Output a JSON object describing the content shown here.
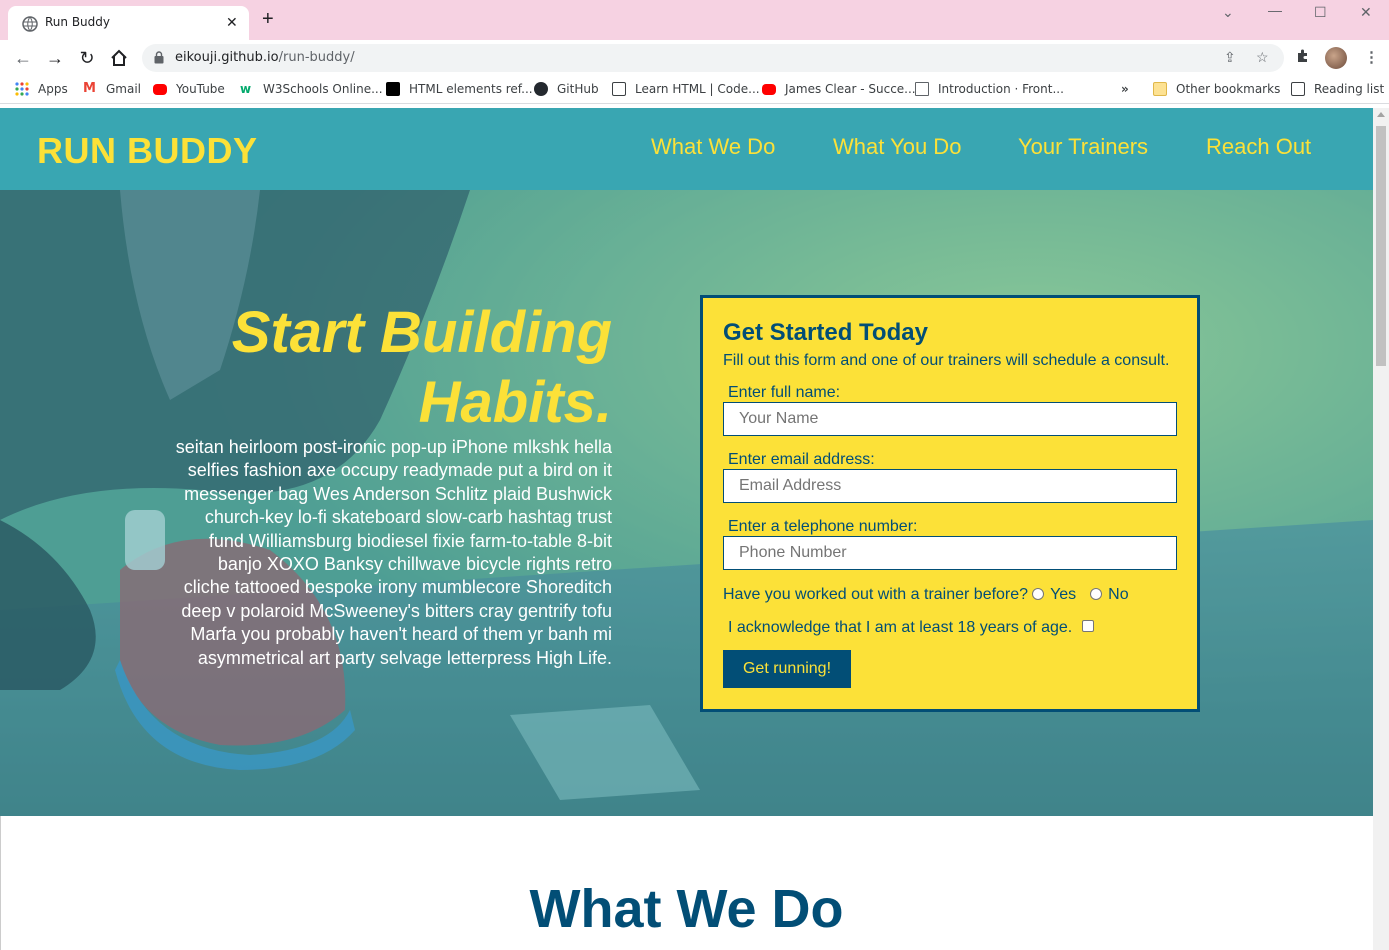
{
  "browser": {
    "tab_title": "Run Buddy",
    "url_host": "eikouji.github.io",
    "url_path": "/run-buddy/",
    "bookmarks": [
      {
        "label": "Apps",
        "icon": "apps-grid-icon",
        "color": "#4285f4"
      },
      {
        "label": "Gmail",
        "icon": "gmail-icon",
        "color": "#ea4335"
      },
      {
        "label": "YouTube",
        "icon": "youtube-icon",
        "color": "#ff0000"
      },
      {
        "label": "W3Schools Online...",
        "icon": "w3schools-icon",
        "color": "#04aa6d"
      },
      {
        "label": "HTML elements ref...",
        "icon": "mdn-icon",
        "color": "#000000"
      },
      {
        "label": "GitHub",
        "icon": "github-icon",
        "color": "#24292f"
      },
      {
        "label": "Learn HTML | Code...",
        "icon": "codecademy-icon",
        "color": "#3c4043"
      },
      {
        "label": "James Clear - Succe...",
        "icon": "youtube-icon",
        "color": "#ff0000"
      },
      {
        "label": "Introduction · Front...",
        "icon": "book-icon",
        "color": "#5f6368"
      }
    ],
    "more_bookmarks": "»",
    "other_bookmarks": "Other bookmarks",
    "reading_list": "Reading list"
  },
  "header": {
    "logo": "RUN BUDDY",
    "nav": [
      "What We Do",
      "What You Do",
      "Your Trainers",
      "Reach Out"
    ]
  },
  "hero": {
    "title_line1": "Start Building",
    "title_line2": "Habits.",
    "text": "seitan heirloom post-ironic pop-up iPhone mlkshk hella selfies fashion axe occupy readymade put a bird on it messenger bag Wes Anderson Schlitz plaid Bushwick church-key lo-fi skateboard slow-carb hashtag trust fund Williamsburg biodiesel fixie farm-to-table 8-bit banjo XOXO Banksy chillwave bicycle rights retro cliche tattooed bespoke irony mumblecore Shoreditch deep v polaroid McSweeney's bitters cray gentrify tofu Marfa you probably haven't heard of them yr banh mi asymmetrical art party selvage letterpress High Life."
  },
  "form": {
    "title": "Get Started Today",
    "subtitle": "Fill out this form and one of our trainers will schedule a consult.",
    "name_label": "Enter full name:",
    "name_placeholder": "Your Name",
    "email_label": "Enter email address:",
    "email_placeholder": "Email Address",
    "phone_label": "Enter a telephone number:",
    "phone_placeholder": "Phone Number",
    "trainer_question": "Have you worked out with a trainer before?",
    "yes": "Yes",
    "no": "No",
    "age_ack": "I acknowledge that I am at least 18 years of age.",
    "submit": "Get running!"
  },
  "sections": {
    "what_we_do": "What We Do"
  },
  "colors": {
    "primary_teal": "#39a6b2",
    "accent_yellow": "#fce138",
    "dark_blue": "#024e76"
  }
}
